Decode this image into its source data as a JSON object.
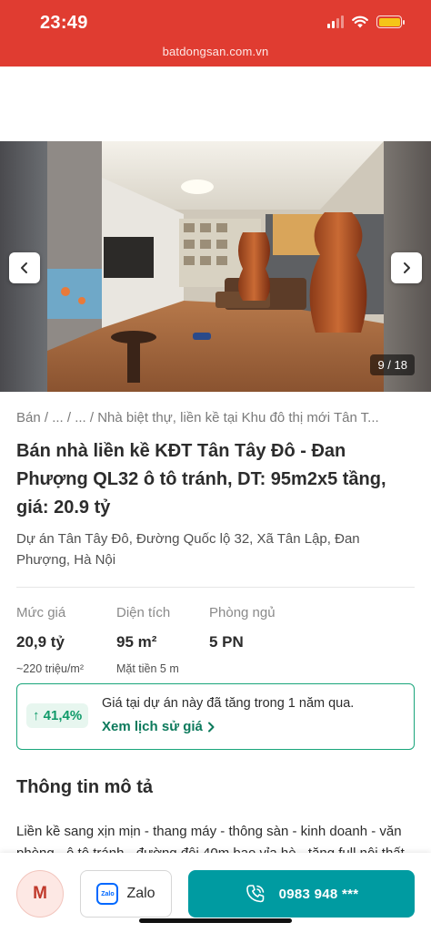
{
  "status_bar": {
    "time": "23:49",
    "url": "batdongsan.com.vn",
    "bar_color": "#e03c31",
    "battery_color": "#f5c518"
  },
  "gallery": {
    "counter": "9 / 18",
    "prev_icon": "chevron-left-icon",
    "next_icon": "chevron-right-icon"
  },
  "listing": {
    "breadcrumb": "Bán / ... / ... / Nhà biệt thự, liền kề tại Khu đô thị mới Tân T...",
    "title": "Bán nhà liền kề KĐT Tân Tây Đô - Đan Phượng QL32 ô tô tránh, DT: 95m2x5 tầng, giá: 20.9 tỷ",
    "address": "Dự án Tân Tây Đô, Đường Quốc lộ 32, Xã Tân Lập, Đan Phượng, Hà Nội"
  },
  "specs": [
    {
      "label": "Mức giá",
      "value": "20,9 tỷ",
      "sub": "~220 triệu/m²"
    },
    {
      "label": "Diện tích",
      "value": "95 m²",
      "sub": "Mặt tiền 5 m"
    },
    {
      "label": "Phòng ngủ",
      "value": "5 PN",
      "sub": ""
    }
  ],
  "price_trend": {
    "badge": "↑ 41,4%",
    "text": "Giá tại dự án này đã tăng trong 1 năm qua.",
    "link": "Xem lịch sử giá",
    "accent": "#19a57b"
  },
  "description": {
    "heading": "Thông tin mô tả",
    "text": "Liền kề sang xịn mịn - thang máy - thông sàn - kinh doanh - văn phòng - ô tô tránh - đường đôi 40m bao vỉa hè - tặng full nội thất."
  },
  "contact": {
    "avatar_initial": "M",
    "zalo_logo": "Zalo",
    "zalo_label": "Zalo",
    "phone": "0983 948 ***",
    "call_color": "#009ba1"
  }
}
